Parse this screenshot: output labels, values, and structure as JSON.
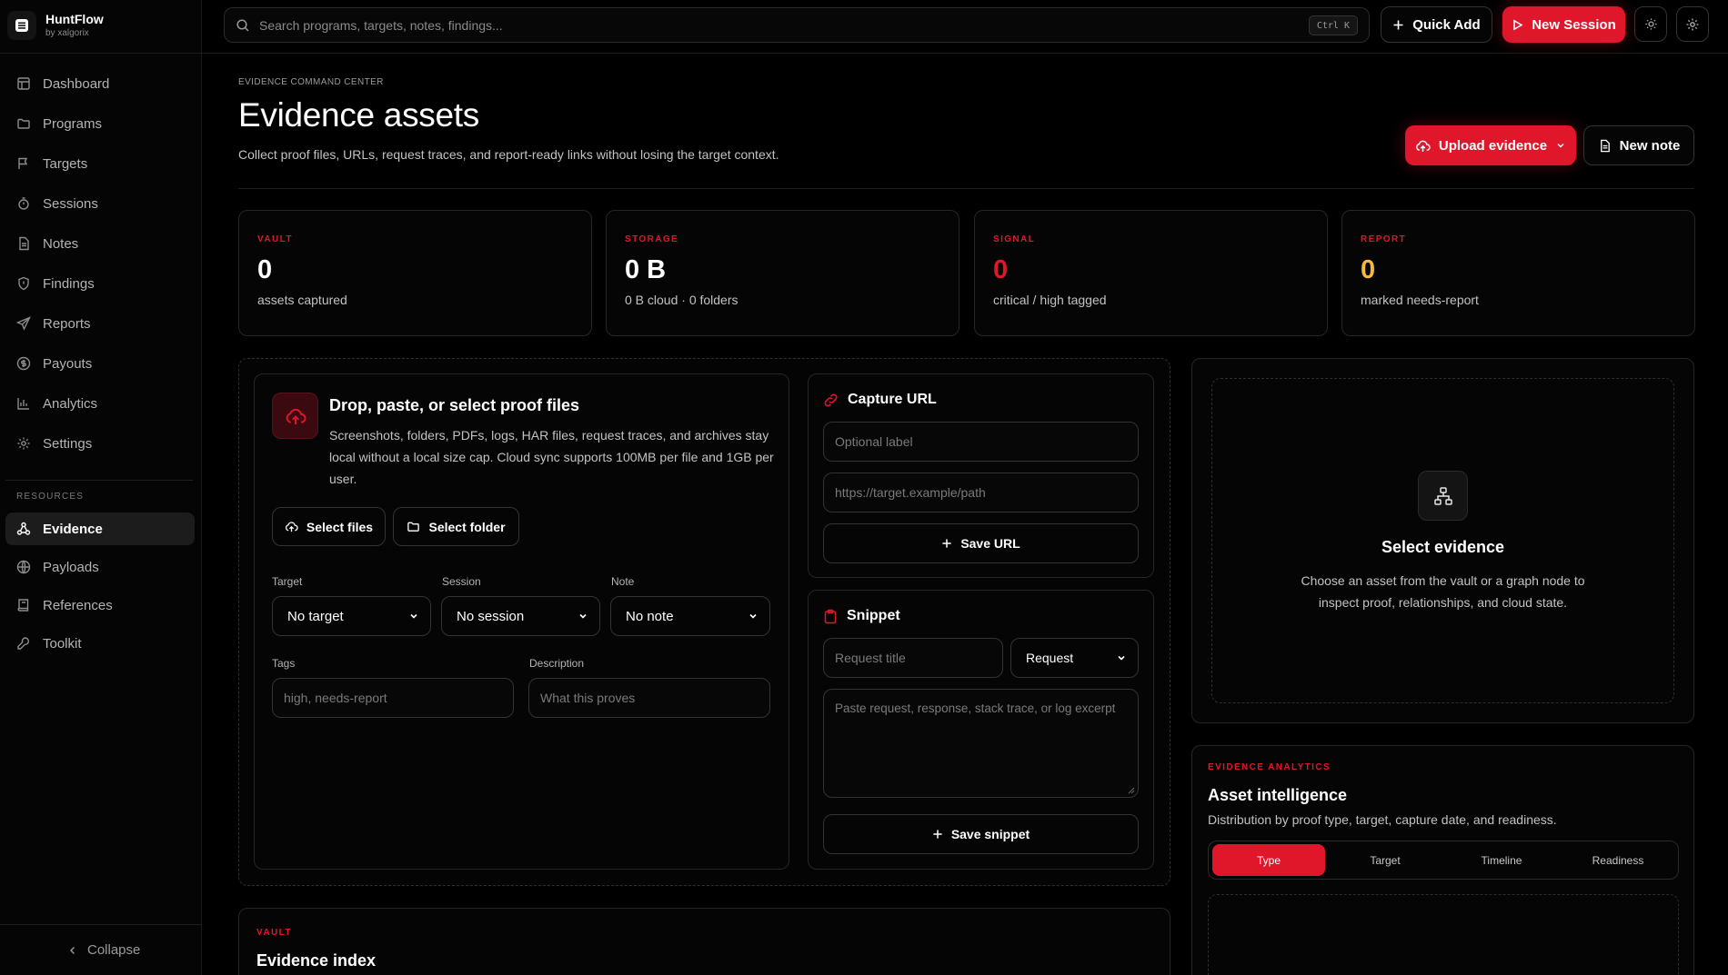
{
  "brand": {
    "name": "HuntFlow",
    "byline": "by xalgorix"
  },
  "nav": [
    {
      "label": "Dashboard",
      "icon": "grid-icon"
    },
    {
      "label": "Programs",
      "icon": "folder-icon"
    },
    {
      "label": "Targets",
      "icon": "flag-icon"
    },
    {
      "label": "Sessions",
      "icon": "timer-icon"
    },
    {
      "label": "Notes",
      "icon": "file-text-icon"
    },
    {
      "label": "Findings",
      "icon": "shield-icon"
    },
    {
      "label": "Reports",
      "icon": "send-icon"
    },
    {
      "label": "Payouts",
      "icon": "dollar-icon"
    },
    {
      "label": "Analytics",
      "icon": "bar-chart-icon"
    },
    {
      "label": "Settings",
      "icon": "gear-icon"
    }
  ],
  "resources": {
    "label": "RESOURCES",
    "items": [
      {
        "label": "Evidence",
        "icon": "network-icon",
        "active": true
      },
      {
        "label": "Payloads",
        "icon": "globe-icon"
      },
      {
        "label": "References",
        "icon": "book-icon"
      },
      {
        "label": "Toolkit",
        "icon": "wrench-icon"
      }
    ]
  },
  "collapse_label": "Collapse",
  "topbar": {
    "search_placeholder": "Search programs, targets, notes, findings...",
    "shortcut": "Ctrl K",
    "quick_add": "Quick Add",
    "new_session": "New Session"
  },
  "header": {
    "kicker": "EVIDENCE COMMAND CENTER",
    "title": "Evidence assets",
    "subtitle": "Collect proof files, URLs, request traces, and report-ready links without losing the target context.",
    "upload_label": "Upload evidence",
    "new_note_label": "New note"
  },
  "stats": [
    {
      "label": "VAULT",
      "value": "0",
      "desc": "assets captured",
      "color": "#ffffff"
    },
    {
      "label": "STORAGE",
      "value": "0 B",
      "desc": "0 B cloud · 0 folders",
      "color": "#ffffff"
    },
    {
      "label": "SIGNAL",
      "value": "0",
      "desc": "critical / high tagged",
      "color": "#e0162b"
    },
    {
      "label": "REPORT",
      "value": "0",
      "desc": "marked needs-report",
      "color": "#f5b940"
    }
  ],
  "upload": {
    "title": "Drop, paste, or select proof files",
    "description": "Screenshots, folders, PDFs, logs, HAR files, request traces, and archives stay local without a local size cap. Cloud sync supports 100MB per file and 1GB per user.",
    "select_files": "Select files",
    "select_folder": "Select folder",
    "target_label": "Target",
    "target_value": "No target",
    "session_label": "Session",
    "session_value": "No session",
    "note_label": "Note",
    "note_value": "No note",
    "tags_label": "Tags",
    "tags_placeholder": "high, needs-report",
    "description_label": "Description",
    "description_placeholder": "What this proves"
  },
  "capture_url": {
    "title": "Capture URL",
    "label_placeholder": "Optional label",
    "url_placeholder": "https://target.example/path",
    "save_label": "Save URL"
  },
  "snippet": {
    "title": "Snippet",
    "title_placeholder": "Request title",
    "type_value": "Request",
    "body_placeholder": "Paste request, response, stack trace, or log excerpt",
    "save_label": "Save snippet"
  },
  "select_evidence": {
    "title": "Select evidence",
    "description": "Choose an asset from the vault or a graph node to inspect proof, relationships, and cloud state."
  },
  "analytics": {
    "kicker": "EVIDENCE ANALYTICS",
    "title": "Asset intelligence",
    "subtitle": "Distribution by proof type, target, capture date, and readiness.",
    "tabs": [
      "Type",
      "Target",
      "Timeline",
      "Readiness"
    ]
  },
  "vault_index": {
    "kicker": "VAULT",
    "title": "Evidence index"
  }
}
